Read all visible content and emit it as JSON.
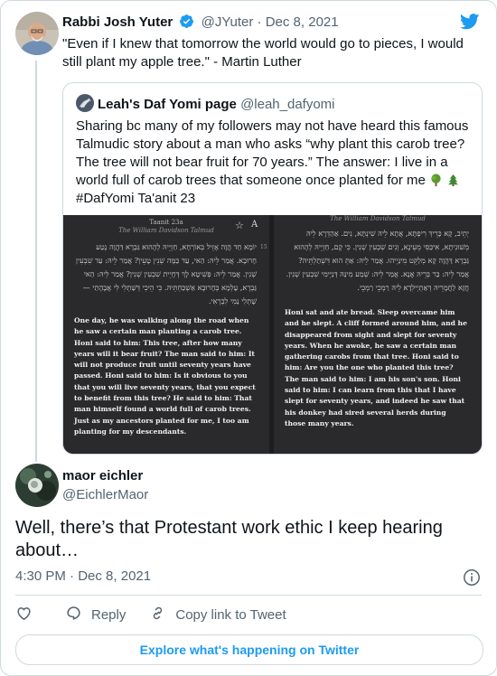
{
  "tweet": {
    "author_name": "Rabbi Josh Yuter",
    "handle": "@JYuter",
    "separator": "·",
    "date": "Dec 8, 2021",
    "text": "\"Even if I knew that tomorrow the world would go to pieces, I would still plant my apple tree.\" - Martin Luther"
  },
  "quoted": {
    "author_name": "Leah's Daf Yomi page",
    "handle": "@leah_dafyomi",
    "text": "Sharing bc many of my followers may not have heard this famous Talmudic story about a man who asks “why plant this carob tree? The tree will not bear fruit for 70 years.” The answer: I live in a world full of carob trees that someone once planted for me",
    "text_line2": "#DafYomi Ta'anit 23",
    "emojis": [
      "deciduous-tree",
      "evergreen-tree"
    ],
    "page_left": {
      "title": "Taanit 23a",
      "subtitle": "The William Davidson Talmud",
      "page_number": "15",
      "hebrew": "יוֹמָא חַד הֲוָה אָזֵיל בְּאוֹרְחָא, חַזְיֵיהּ לְהָהוּא גַּבְרָא דַּהֲוָה נָטַע חָרוּבָא. אֲמַר לֵיהּ: הַאי, עַד כַּמָּה שְׁנִין טָעֵין? אֲמַר לֵיהּ: עַד שִׁבְעִין שְׁנִין. אֲמַר לֵיהּ: פְּשִׁיטָא לָךְ דְּחָיֵית שִׁבְעִין שְׁנִין? אֲמַר לֵיהּ: הַאי גַּבְרָא, עָלְמָא בְּחָרוּבָא אַשְׁכַּחְתֵּיהּ. כִּי הֵיכִי דְּשַׁתְלִי לִי אֲבָהָתַי — שָׁתְלִי נַמִי לִבְרָאִי.",
      "english": "One day, he was walking along the road when he saw a certain man planting a carob tree. Honi said to him: This tree, after how many years will it bear fruit? The man said to him: It will not produce fruit until seventy years have passed. Honi said to him: Is it obvious to you that you will live seventy years, that you expect to benefit from this tree? He said to him: That man himself found a world full of carob trees. Just as my ancestors planted for me, I too am planting for my descendants."
    },
    "page_right": {
      "subtitle": "The William Davidson Talmud",
      "hebrew": "יְתֵיב, קָא כָּרֵיךְ רִיפְתָּא, אֲתָא לֵיהּ שִׁינְתָּא, נִים. אַהַדְרָא לֵיהּ מְשׁוּנִיתָא, אִיכַּסִּי מֵעֵינָא, וְנִים שִׁבְעִין שְׁנִין. כִּי קָם, חַזְיֵיהּ לְהָהוּא גַּבְרָא דַּהֲוָה קָא מְלַקֵּט מִינַּיְיהוּ. אֲמַר לֵיהּ: אַתְּ הוּא דִּשְׁתַלְתֵּיהּ? אֲמַר לֵיהּ: בַּר בְּרֵיהּ אֲנָא. אֲמַר לֵיהּ: שְׁמַע מִינַּהּ דְּנַיְימִי שִׁבְעִין שְׁנִין. חֲזָא לַחֲמָרֵיהּ דְּאַתְיְילִדָא לֵיהּ רַמְכֵי רַמְכֵי.",
      "english": "Honi sat and ate bread. Sleep overcame him and he slept. A cliff formed around him, and he disappeared from sight and slept for seventy years. When he awoke, he saw a certain man gathering carobs from that tree. Honi said to him: Are you the one who planted this tree? The man said to him: I am his son's son. Honi said to him: I can learn from this that I have slept for seventy years, and indeed he saw that his donkey had sired several herds during those many years."
    }
  },
  "reply": {
    "author_name": "maor eichler",
    "handle": "@EichlerMaor",
    "text": "Well, there’s that Protestant work ethic I keep hearing about…",
    "time": "4:30 PM",
    "separator": "·",
    "date": "Dec 8, 2021"
  },
  "actions": {
    "like_icon": "heart-icon",
    "reply_label": "Reply",
    "copy_label": "Copy link to Tweet"
  },
  "footer": {
    "explore_label": "Explore what's happening on Twitter"
  },
  "colors": {
    "twitter_blue": "#1d9bf0",
    "muted": "#536471",
    "border": "#cfd9de"
  }
}
